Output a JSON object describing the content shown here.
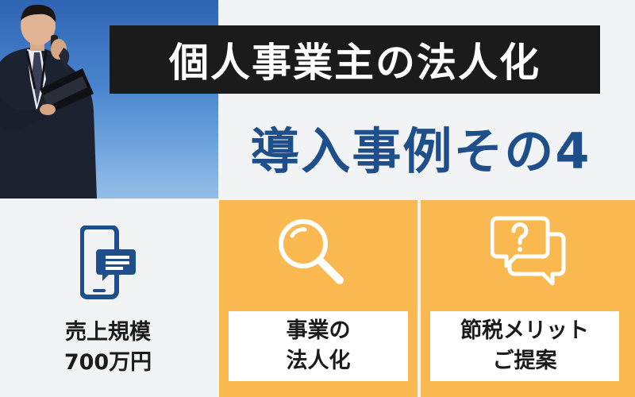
{
  "title": "個人事業主の法人化",
  "subtitle": "導入事例その4",
  "cards": [
    {
      "icon": "smartphone-message-icon",
      "line1": "売上規模",
      "line2": "700万円"
    },
    {
      "icon": "magnifying-glass-icon",
      "line1": "事業の",
      "line2": "法人化"
    },
    {
      "icon": "question-speech-bubbles-icon",
      "line1": "節税メリット",
      "line2": "ご提案"
    }
  ],
  "colors": {
    "title_bg": "#1b1b1b",
    "subtitle": "#1e4f8a",
    "card_accent": "#f9b850",
    "icon_blue": "#1e4f8a",
    "background": "#f2f3f5"
  }
}
